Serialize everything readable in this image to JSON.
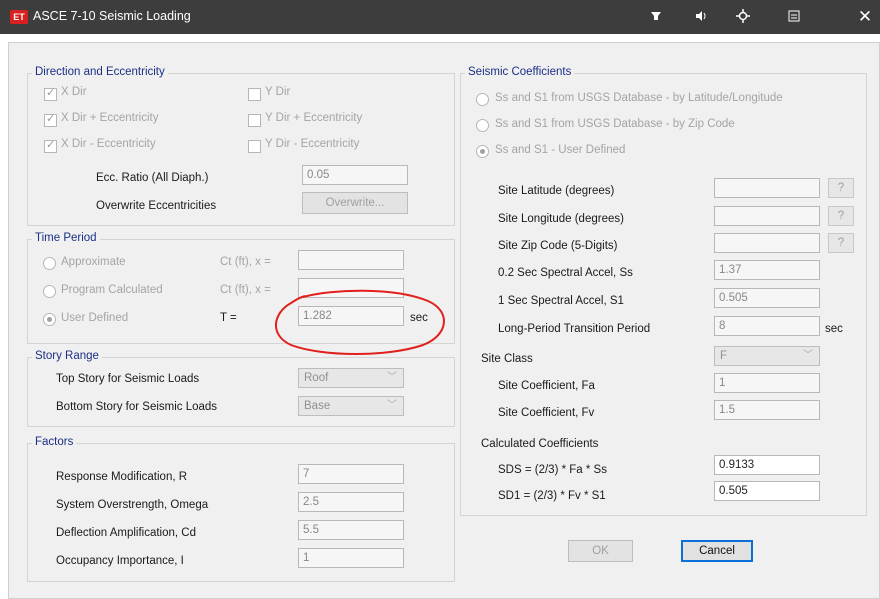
{
  "window": {
    "app_badge": "ET",
    "title": "ASCE 7-10 Seismic Loading",
    "close_glyph": "✕"
  },
  "direction": {
    "title": "Direction and Eccentricity",
    "x_dir": "X Dir",
    "y_dir": "Y Dir",
    "x_dir_plus": "X Dir + Eccentricity",
    "y_dir_plus": "Y Dir + Eccentricity",
    "x_dir_minus": "X Dir - Eccentricity",
    "y_dir_minus": "Y Dir - Eccentricity",
    "ecc_ratio_label": "Ecc. Ratio (All Diaph.)",
    "ecc_ratio_value": "0.05",
    "overwrite_label": "Overwrite Eccentricities",
    "overwrite_button": "Overwrite..."
  },
  "time_period": {
    "title": "Time Period",
    "approximate": "Approximate",
    "program_calculated": "Program Calculated",
    "user_defined": "User Defined",
    "ct_label_1": "Ct (ft), x =",
    "ct_label_2": "Ct (ft), x =",
    "t_label": "T =",
    "t_value": "1.282",
    "t_unit": "sec"
  },
  "story_range": {
    "title": "Story Range",
    "top_label": "Top Story for Seismic Loads",
    "top_value": "Roof",
    "bottom_label": "Bottom Story for Seismic Loads",
    "bottom_value": "Base"
  },
  "factors": {
    "title": "Factors",
    "r_label": "Response Modification, R",
    "r_value": "7",
    "omega_label": "System Overstrength, Omega",
    "omega_value": "2.5",
    "cd_label": "Deflection Amplification, Cd",
    "cd_value": "5.5",
    "i_label": "Occupancy Importance, I",
    "i_value": "1"
  },
  "seismic": {
    "title": "Seismic Coefficients",
    "opt_lat_long": "Ss and S1 from USGS Database - by Latitude/Longitude",
    "opt_zip": "Ss and S1 from USGS Database - by Zip Code",
    "opt_user": "Ss and S1 - User Defined",
    "lat_label": "Site Latitude (degrees)",
    "long_label": "Site Longitude (degrees)",
    "zip_label": "Site Zip Code (5-Digits)",
    "q": "?",
    "ss_label": "0.2 Sec Spectral Accel, Ss",
    "ss_value": "1.37",
    "s1_label": "1 Sec Spectral Accel, S1",
    "s1_value": "0.505",
    "tl_label": "Long-Period Transition Period",
    "tl_value": "8",
    "tl_unit": "sec",
    "site_class_label": "Site Class",
    "site_class_value": "F",
    "fa_label": "Site Coefficient, Fa",
    "fa_value": "1",
    "fv_label": "Site Coefficient, Fv",
    "fv_value": "1.5",
    "calc_label": "Calculated Coefficients",
    "sds_label": "SDS = (2/3) * Fa * Ss",
    "sds_value": "0.9133",
    "sd1_label": "SD1 = (2/3) * Fv * S1",
    "sd1_value": "0.505"
  },
  "buttons": {
    "ok": "OK",
    "cancel": "Cancel"
  },
  "colors": {
    "annotation": "#e0201c",
    "group_title": "#1b2f86",
    "cancel_border": "#0a6fd6"
  }
}
